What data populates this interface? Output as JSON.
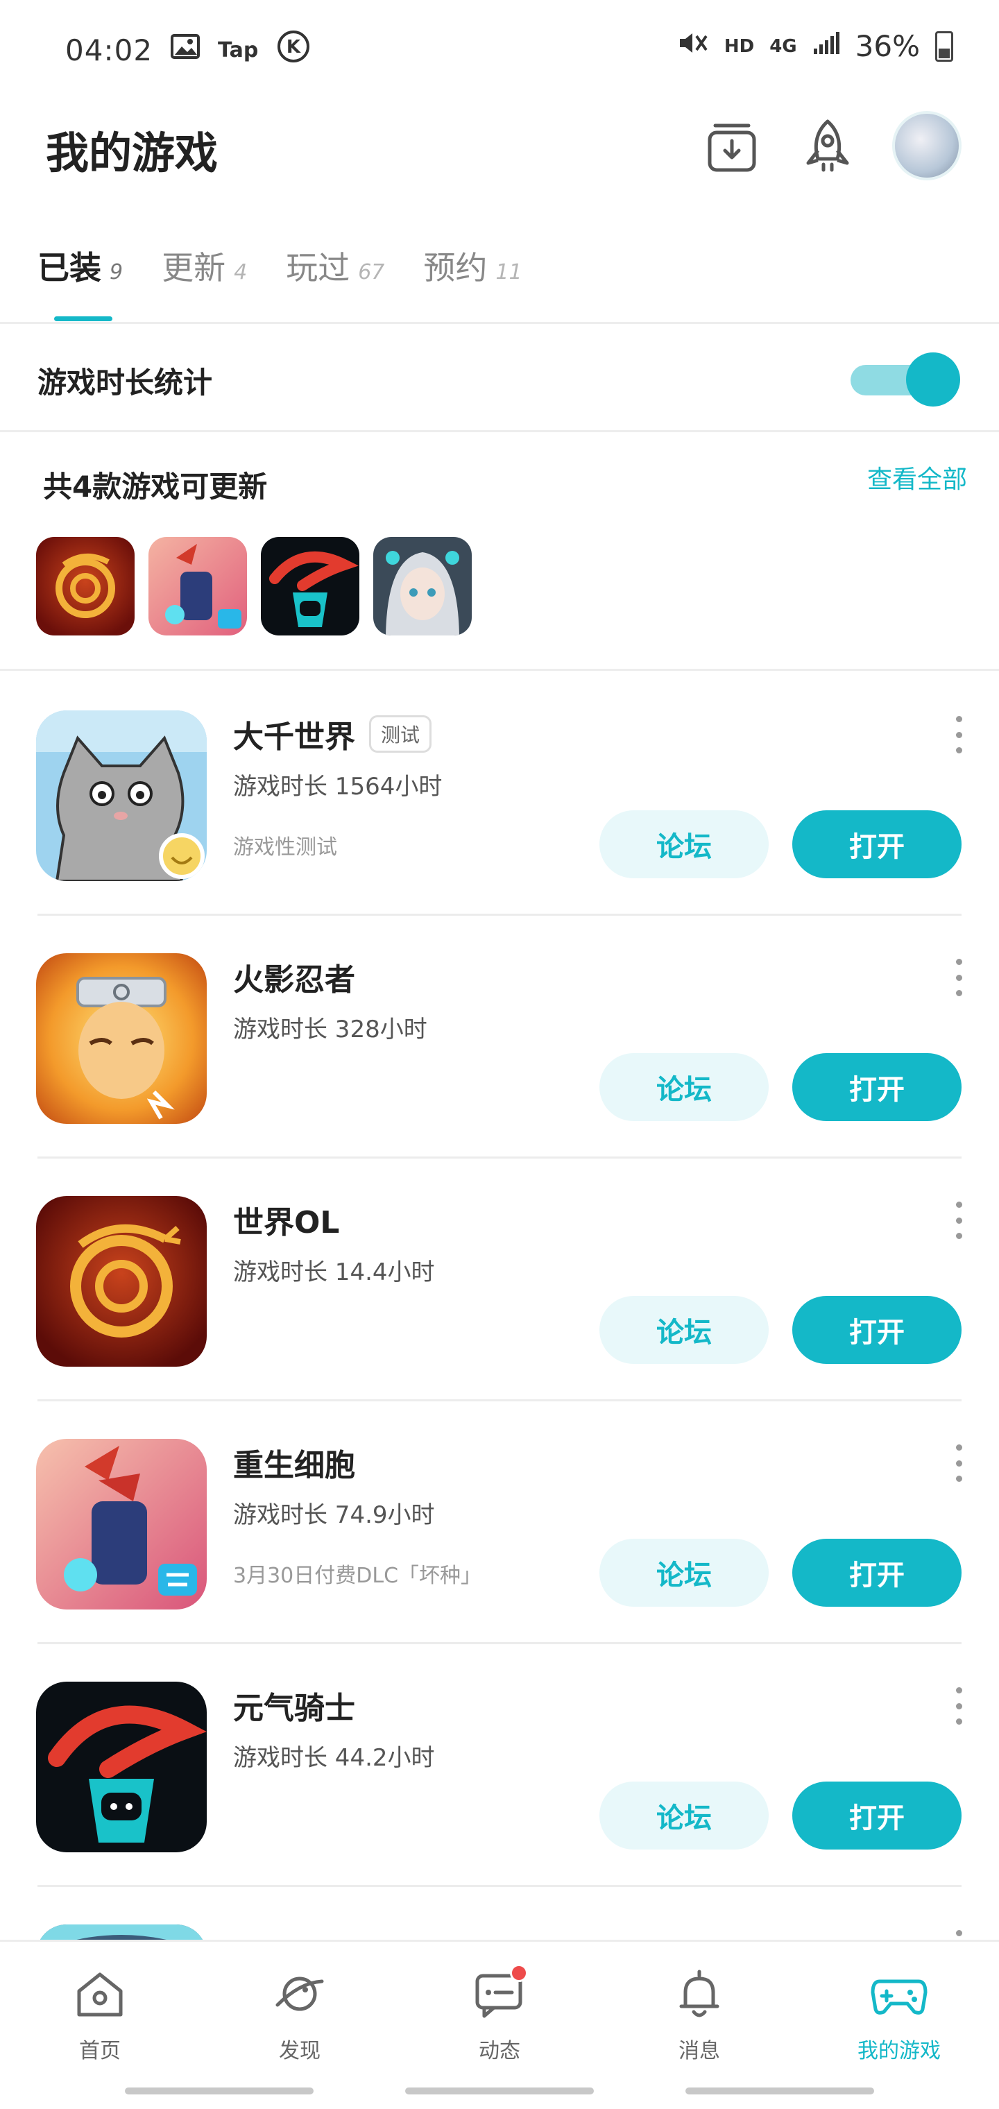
{
  "status_bar": {
    "time": "04:02",
    "tap_label": "Tap",
    "k_label": "K",
    "hd_label": "HD",
    "network_label": "4G",
    "battery_text": "36%"
  },
  "header": {
    "title": "我的游戏"
  },
  "tabs": [
    {
      "label": "已装",
      "count": "9"
    },
    {
      "label": "更新",
      "count": "4"
    },
    {
      "label": "玩过",
      "count": "67"
    },
    {
      "label": "预约",
      "count": "11"
    }
  ],
  "stats": {
    "label": "游戏时长统计",
    "enabled": true
  },
  "updates": {
    "title": "共4款游戏可更新",
    "view_all": "查看全部"
  },
  "games": [
    {
      "name": "大千世界",
      "badge": "测试",
      "time": "游戏时长 1564小时",
      "note": "游戏性测试",
      "forum": "论坛",
      "open": "打开"
    },
    {
      "name": "火影忍者",
      "badge": "",
      "time": "游戏时长 328小时",
      "note": "",
      "forum": "论坛",
      "open": "打开"
    },
    {
      "name": "世界OL",
      "badge": "",
      "time": "游戏时长 14.4小时",
      "note": "",
      "forum": "论坛",
      "open": "打开"
    },
    {
      "name": "重生细胞",
      "badge": "",
      "time": "游戏时长 74.9小时",
      "note": "3月30日付费DLC「坏种」",
      "forum": "论坛",
      "open": "打开"
    },
    {
      "name": "元气骑士",
      "badge": "",
      "time": "游戏时长 44.2小时",
      "note": "",
      "forum": "论坛",
      "open": "打开"
    }
  ],
  "bottom_nav": [
    {
      "label": "首页",
      "icon": "home-icon"
    },
    {
      "label": "发现",
      "icon": "planet-icon"
    },
    {
      "label": "动态",
      "icon": "chat-icon"
    },
    {
      "label": "消息",
      "icon": "bell-icon"
    },
    {
      "label": "我的游戏",
      "icon": "gamepad-icon"
    }
  ],
  "colors": {
    "accent": "#14b8c8",
    "accent_light": "#e8f8fa",
    "badge_red": "#ee4b4b"
  }
}
